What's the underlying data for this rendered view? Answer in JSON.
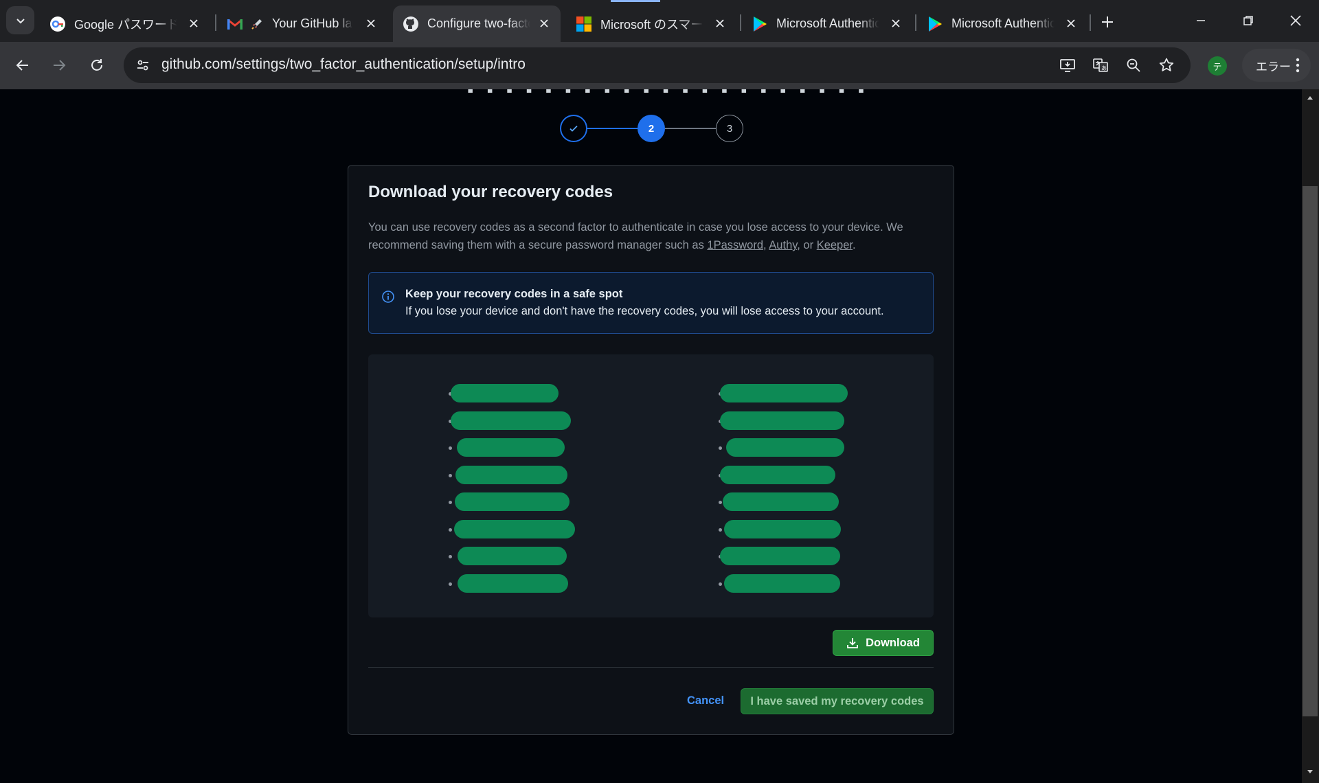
{
  "browser": {
    "tabs": [
      {
        "title": "Google パスワード マネージャー",
        "favicon": "google-password-manager-icon"
      },
      {
        "title": "Your GitHub launch code",
        "favicon": "gmail-icon"
      },
      {
        "title": "Configure two-factor authentication",
        "favicon": "github-icon",
        "active": true
      },
      {
        "title": "Microsoft のスマートフォン",
        "favicon": "microsoft-icon"
      },
      {
        "title": "Microsoft Authenticator",
        "favicon": "google-play-icon"
      },
      {
        "title": "Microsoft Authenticator",
        "favicon": "google-play-icon"
      }
    ],
    "url": "github.com/settings/two_factor_authentication/setup/intro",
    "profile_initial": "テ",
    "error_label": "エラー"
  },
  "stepper": {
    "steps": [
      "✓",
      "2",
      "3"
    ],
    "current_step": 2
  },
  "card": {
    "title": "Download your recovery codes",
    "desc_pre": "You can use recovery codes as a second factor to authenticate in case you lose access to your device. We recommend saving them with a secure password manager such as ",
    "links": [
      "1Password",
      "Authy",
      "Keeper"
    ],
    "desc_sep1": ", ",
    "desc_sep2": ", or ",
    "desc_post": ".",
    "flash_title": "Keep your recovery codes in a safe spot",
    "flash_body": "If you lose your device and don't have the recovery codes, you will lose access to your account.",
    "download_label": "Download",
    "cancel_label": "Cancel",
    "saved_label": "I have saved my recovery codes"
  },
  "recovery_codes": {
    "count_per_column": 8,
    "columns": 2,
    "redacted": true
  },
  "colors": {
    "primary_blue": "#1f6feb",
    "button_green": "#238636",
    "redaction_green": "#0d8a55",
    "link_blue": "#4493f8"
  }
}
